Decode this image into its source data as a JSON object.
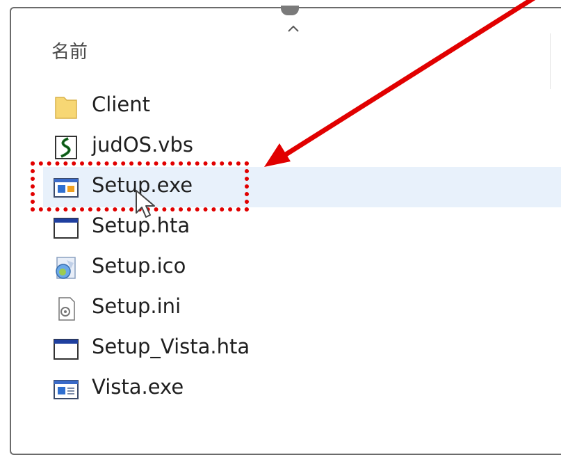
{
  "column_header": {
    "name": "名前"
  },
  "files": [
    {
      "name": "Client",
      "icon": "folder-icon",
      "selected": false
    },
    {
      "name": "judOS.vbs",
      "icon": "vbs-script-icon",
      "selected": false
    },
    {
      "name": "Setup.exe",
      "icon": "exe-app-icon",
      "selected": true
    },
    {
      "name": "Setup.hta",
      "icon": "hta-window-icon",
      "selected": false
    },
    {
      "name": "Setup.ico",
      "icon": "ico-image-icon",
      "selected": false
    },
    {
      "name": "Setup.ini",
      "icon": "ini-settings-icon",
      "selected": false
    },
    {
      "name": "Setup_Vista.hta",
      "icon": "hta-window-icon",
      "selected": false
    },
    {
      "name": "Vista.exe",
      "icon": "exe-app-icon",
      "selected": false
    }
  ],
  "colors": {
    "annotation": "#e10000",
    "selection_bg": "#e8f1fb",
    "folder": "#f7d774"
  }
}
